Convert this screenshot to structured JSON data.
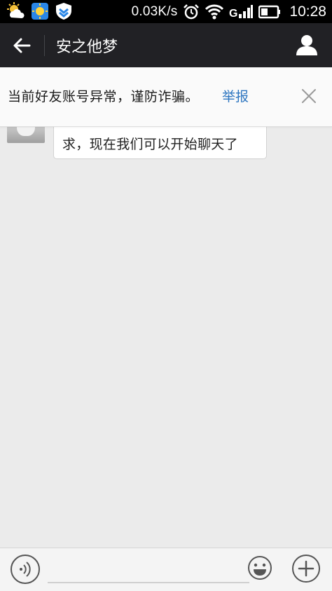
{
  "status_bar": {
    "net_speed": "0.03K/s",
    "time": "10:28",
    "icons": [
      "weather-icon",
      "app-icon",
      "shield-icon",
      "alarm-icon",
      "wifi-icon",
      "signal-icon",
      "battery-icon"
    ]
  },
  "header": {
    "title": "安之他梦",
    "back_icon": "back-arrow-icon",
    "profile_icon": "profile-icon"
  },
  "warning": {
    "text": "当前好友账号异常，谨防诈骗。",
    "report_label": "举报",
    "close_icon": "close-icon"
  },
  "chat": {
    "messages": [
      {
        "sender": "friend",
        "line_visible": "求，现在我们可以开始聊天了"
      }
    ]
  },
  "input_bar": {
    "value": "",
    "icons": [
      "voice-icon",
      "emoji-icon",
      "plus-icon"
    ]
  },
  "colors": {
    "status_bar_bg": "#000000",
    "title_bar_bg": "#212125",
    "banner_bg": "#fafafa",
    "link": "#2f77c1",
    "chat_bg": "#ebebeb"
  }
}
